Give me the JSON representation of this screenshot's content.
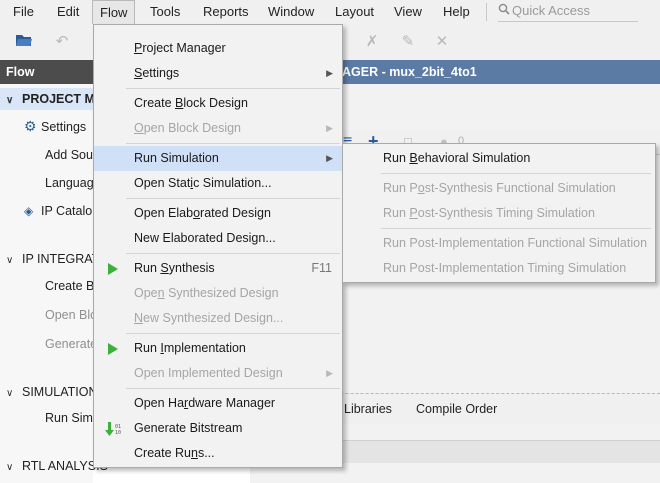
{
  "menubar": {
    "items": [
      {
        "label": "File"
      },
      {
        "label": "Edit"
      },
      {
        "label": "Flow"
      },
      {
        "label": "Tools"
      },
      {
        "label": "Reports"
      },
      {
        "label": "Window"
      },
      {
        "label": "Layout"
      },
      {
        "label": "View"
      },
      {
        "label": "Help"
      }
    ],
    "quick_access_placeholder": "Quick Access"
  },
  "flow_navigator": {
    "title": "Flow Navigator",
    "sections": [
      {
        "label": "PROJECT M"
      },
      {
        "label": "IP INTEGRAT"
      },
      {
        "label": "SIMULATION"
      },
      {
        "label": "RTL ANALYSIS"
      }
    ],
    "items": [
      {
        "label": "Settings"
      },
      {
        "label": "Add Sou"
      },
      {
        "label": "Languag"
      },
      {
        "label": "IP Catalo"
      },
      {
        "label": "Create B"
      },
      {
        "label": "Open Blo"
      },
      {
        "label": "Generate"
      },
      {
        "label": "Run Simu"
      }
    ]
  },
  "main": {
    "header_title": "AGER - mux_2bit_4to1",
    "tabs": [
      {
        "label": "Libraries"
      },
      {
        "label": "Compile Order"
      }
    ],
    "status_count": "0"
  },
  "flow_menu": {
    "items": [
      {
        "pre": "",
        "u": "P",
        "post": "roject Manager"
      },
      {
        "pre": "",
        "u": "S",
        "post": "ettings"
      },
      {
        "pre": "Create ",
        "u": "B",
        "post": "lock Design"
      },
      {
        "pre": "",
        "u": "O",
        "post": "pen Block Design"
      },
      {
        "label": "Run Simulation"
      },
      {
        "pre": "Open Stat",
        "u": "i",
        "post": "c Simulation..."
      },
      {
        "pre": "Open Elab",
        "u": "o",
        "post": "rated Design"
      },
      {
        "label": "New Elaborated Design..."
      },
      {
        "pre": "Run ",
        "u": "S",
        "post": "ynthesis",
        "accel": "F11"
      },
      {
        "pre": "Ope",
        "u": "n",
        "post": " Synthesized Design"
      },
      {
        "pre": "",
        "u": "N",
        "post": "ew Synthesized Design..."
      },
      {
        "pre": "Run ",
        "u": "I",
        "post": "mplementation"
      },
      {
        "label": "Open Implemented Design"
      },
      {
        "pre": "Open Ha",
        "u": "r",
        "post": "dware Manager"
      },
      {
        "label": "Generate Bitstream"
      },
      {
        "pre": "Create Ru",
        "u": "n",
        "post": "s..."
      }
    ]
  },
  "simulation_submenu": {
    "items": [
      {
        "pre": "Run ",
        "u": "B",
        "post": "ehavioral Simulation"
      },
      {
        "pre": "Run P",
        "u": "o",
        "post": "st-Synthesis Functional Simulation"
      },
      {
        "pre": "Run ",
        "u": "P",
        "post": "ost-Synthesis Timing Simulation"
      },
      {
        "pre": "Run Post-Implementation Functional Simulation",
        "u": "",
        "post": ""
      },
      {
        "pre": "Run Post-Implementation Timing Simulation",
        "u": "",
        "post": ""
      }
    ]
  },
  "colors": {
    "highlight": "#cfe0f7",
    "run_icon": "#3bb03b",
    "flow_nav_header": "#4c4c4c",
    "main_header": "#5b7ba4"
  }
}
